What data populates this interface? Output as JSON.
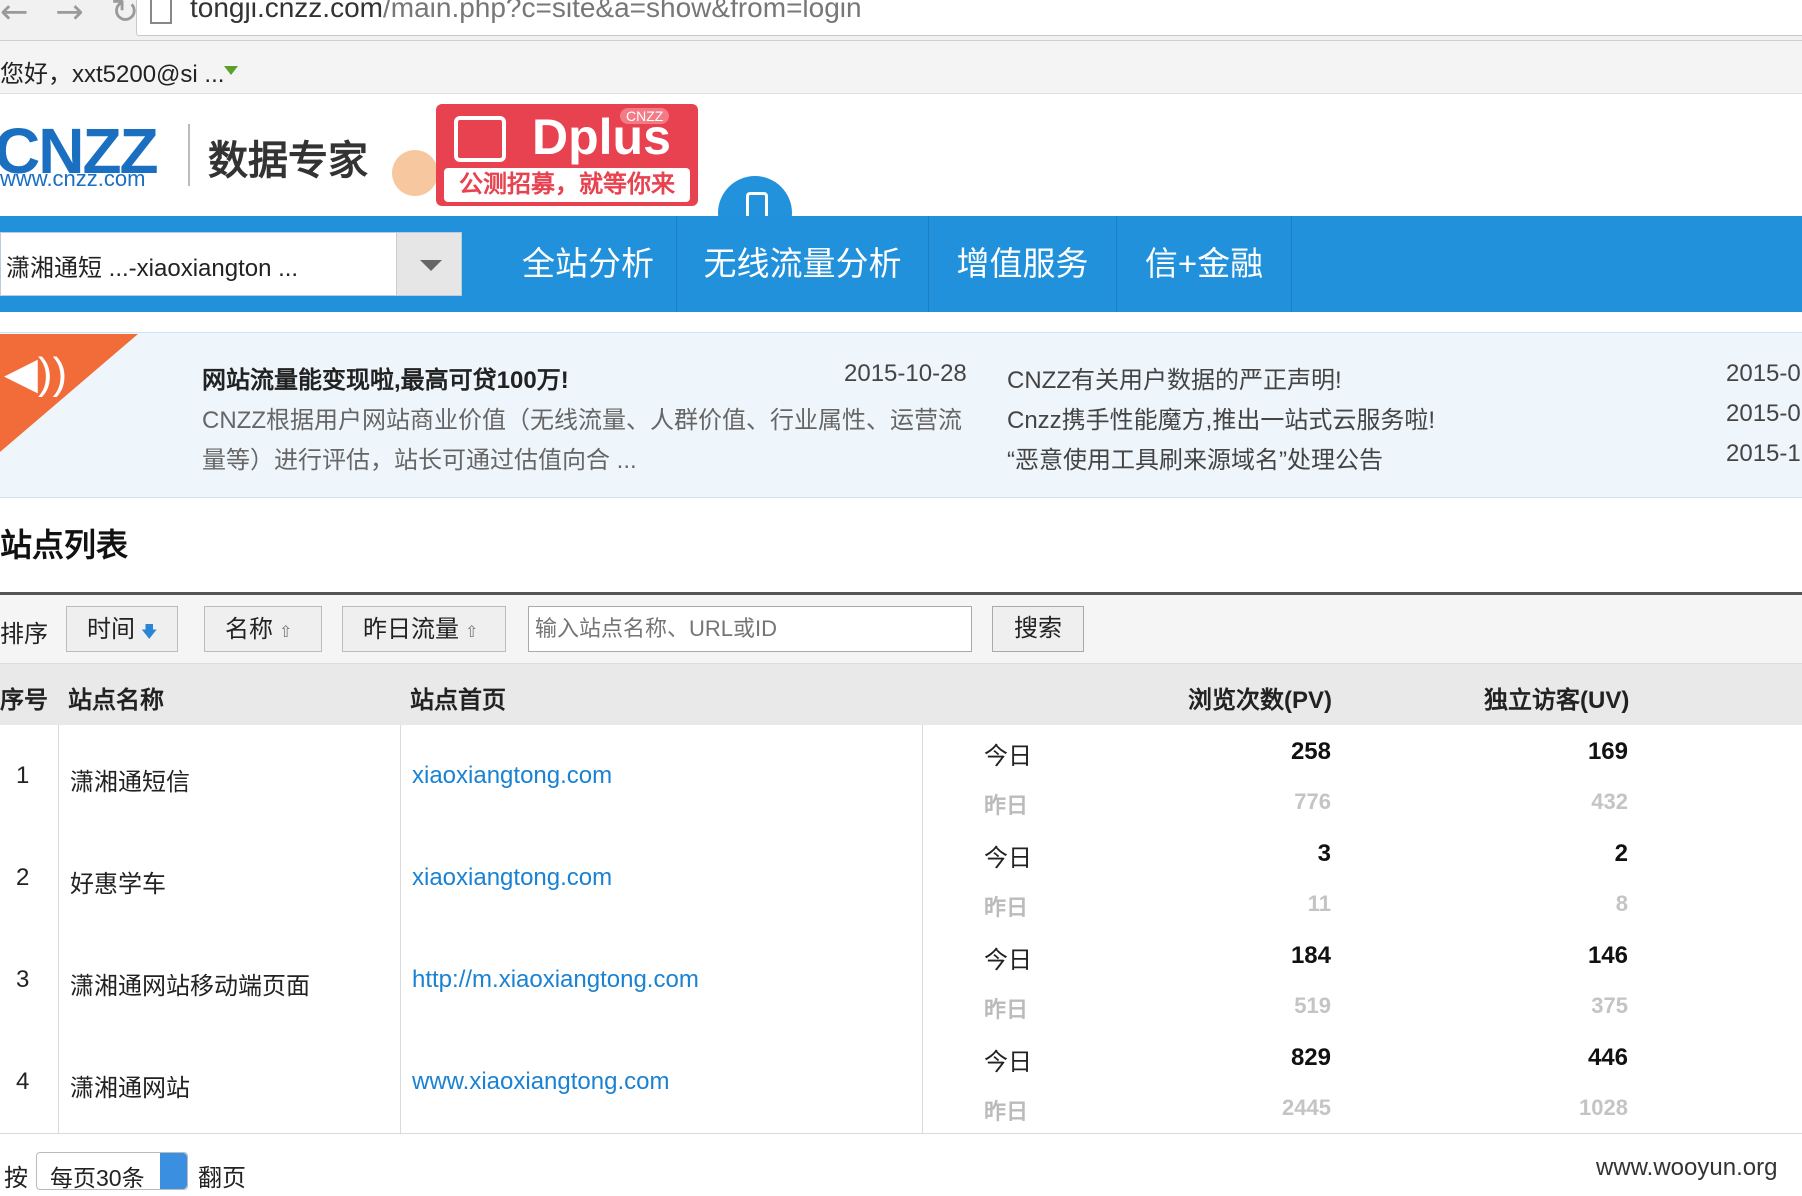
{
  "browser": {
    "url_host": "tongji.cnzz.com",
    "url_path": "/main.php?c=site&a=show&from=login"
  },
  "user": {
    "greeting": "您好，xxt5200@si ..."
  },
  "logo": {
    "brand": "CNZZ",
    "url": "www.cnzz.com",
    "slogan": "数据专家"
  },
  "promo": {
    "title": "Dplus",
    "badge": "CNZZ",
    "subtitle": "公测招募，就等你来"
  },
  "site_selector": {
    "value": "潇湘通短 ...-xiaoxiangton ..."
  },
  "nav": {
    "tabs": [
      "全站分析",
      "无线流量分析",
      "增值服务",
      "信+金融"
    ]
  },
  "notices": {
    "left": {
      "title": "网站流量能变现啦,最高可贷100万!",
      "date": "2015-10-28",
      "body1": "CNZZ根据用户网站商业价值（无线流量、人群价值、行业属性、运营流",
      "body2": "量等）进行评估，站长可通过估值向合 ..."
    },
    "right": [
      {
        "title": "CNZZ有关用户数据的严正声明!",
        "date": "2015-0"
      },
      {
        "title": "Cnzz携手性能魔方,推出一站式云服务啦!",
        "date": "2015-0"
      },
      {
        "title": "“恶意使用工具刷来源域名”处理公告",
        "date": "2015-1"
      }
    ]
  },
  "site_list": {
    "title": "站点列表",
    "sort_label": "排序",
    "sort_buttons": [
      {
        "label": "时间",
        "arrow": "🡇"
      },
      {
        "label": "名称",
        "arrow": "⇧"
      },
      {
        "label": "昨日流量",
        "arrow": "⇧"
      }
    ],
    "search_placeholder": "输入站点名称、URL或ID",
    "search_button": "搜索",
    "columns": {
      "index": "序号",
      "name": "站点名称",
      "home": "站点首页",
      "pv": "浏览次数(PV)",
      "uv": "独立访客(UV)"
    },
    "today_label": "今日",
    "yesterday_label": "昨日",
    "rows": [
      {
        "index": "1",
        "name": "潇湘通短信",
        "home": "xiaoxiangtong.com",
        "pv_today": "258",
        "uv_today": "169",
        "pv_yesterday": "776",
        "uv_yesterday": "432"
      },
      {
        "index": "2",
        "name": "好惠学车",
        "home": "xiaoxiangtong.com",
        "pv_today": "3",
        "uv_today": "2",
        "pv_yesterday": "11",
        "uv_yesterday": "8"
      },
      {
        "index": "3",
        "name": "潇湘通网站移动端页面",
        "home": "http://m.xiaoxiangtong.com",
        "pv_today": "184",
        "uv_today": "146",
        "pv_yesterday": "519",
        "uv_yesterday": "375"
      },
      {
        "index": "4",
        "name": "潇湘通网站",
        "home": "www.xiaoxiangtong.com",
        "pv_today": "829",
        "uv_today": "446",
        "pv_yesterday": "2445",
        "uv_yesterday": "1028"
      }
    ]
  },
  "pager": {
    "prefix": "按",
    "per_page": "每页30条",
    "suffix": "翻页"
  },
  "watermark": "www.wooyun.org",
  "colors": {
    "nav_blue": "#2291dc",
    "link_blue": "#1a82d2",
    "promo_red": "#e8414f",
    "notice_orange": "#f26c3a"
  }
}
